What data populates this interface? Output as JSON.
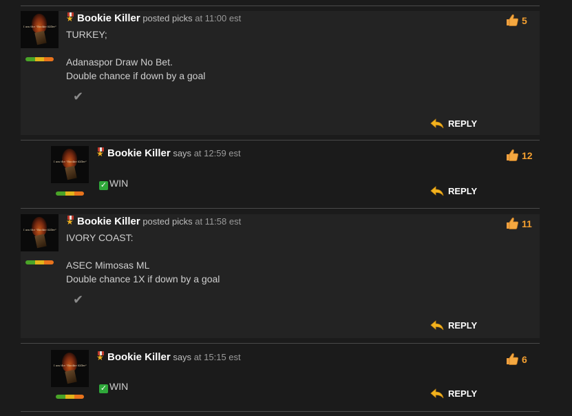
{
  "posts": [
    {
      "author": "Bookie Killer",
      "action": "posted picks",
      "time": "at 11:00 est",
      "body": "TURKEY;\n\nAdanaspor Draw No Bet.\nDouble chance if down by a goal",
      "likes": "5",
      "reply_label": "REPLY"
    },
    {
      "author": "Bookie Killer",
      "action": "says",
      "time": "at 12:59 est",
      "body": "WIN",
      "likes": "12",
      "reply_label": "REPLY"
    },
    {
      "author": "Bookie Killer",
      "action": "posted picks",
      "time": "at 11:58 est",
      "body": "IVORY COAST:\n\nASEC Mimosas ML\nDouble chance 1X if down by a goal",
      "likes": "11",
      "reply_label": "REPLY"
    },
    {
      "author": "Bookie Killer",
      "action": "says",
      "time": "at 15:15 est",
      "body": "WIN",
      "likes": "6",
      "reply_label": "REPLY"
    }
  ],
  "avatar_text": "I am the \"Bookie Killer\"",
  "icons": {
    "medal": "medal-icon",
    "thumbs_up": "thumbs-up-icon",
    "reply": "reply-arrow-icon",
    "check": "checkmark-icon",
    "win": "green-check-box-icon"
  },
  "colors": {
    "background": "#1b1b1b",
    "post_background": "#232323",
    "like_count": "#f5a030",
    "author": "#ffffff",
    "win_box": "#2fa83a"
  }
}
